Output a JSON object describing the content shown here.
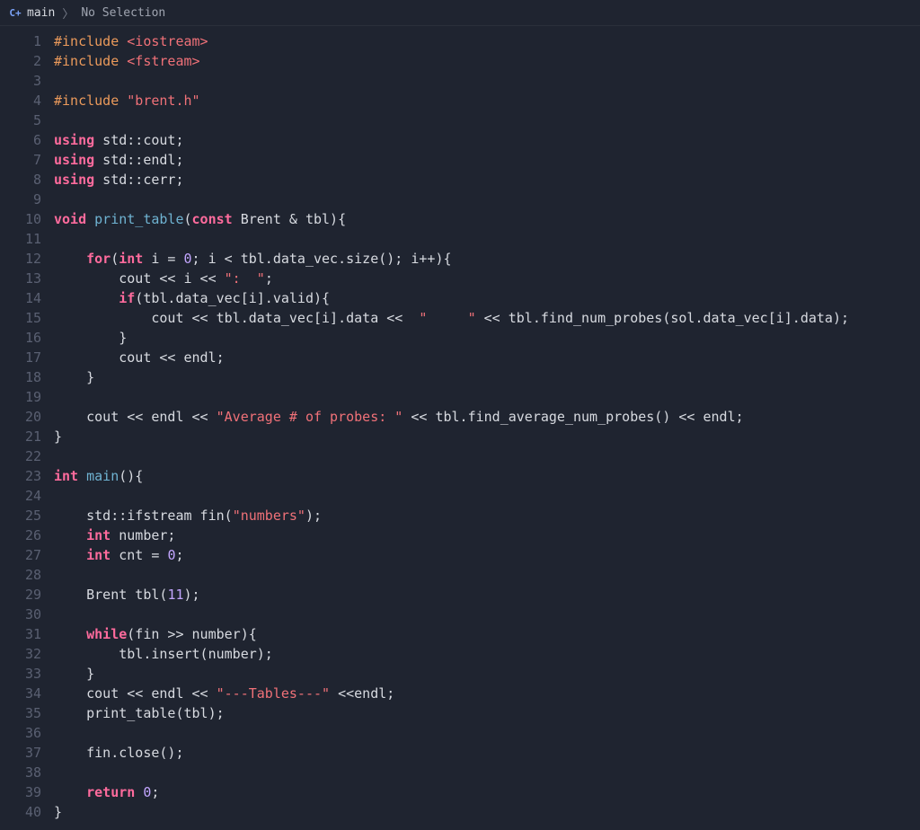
{
  "breadcrumb": {
    "icon_label": "C+",
    "file": "main",
    "selection": "No Selection"
  },
  "code_lines": [
    {
      "n": 1,
      "tokens": [
        [
          "preproc",
          "#include "
        ],
        [
          "string",
          "<iostream>"
        ]
      ]
    },
    {
      "n": 2,
      "tokens": [
        [
          "preproc",
          "#include "
        ],
        [
          "string",
          "<fstream>"
        ]
      ]
    },
    {
      "n": 3,
      "tokens": []
    },
    {
      "n": 4,
      "tokens": [
        [
          "preproc",
          "#include "
        ],
        [
          "string",
          "\"brent.h\""
        ]
      ]
    },
    {
      "n": 5,
      "tokens": []
    },
    {
      "n": 6,
      "tokens": [
        [
          "keyword",
          "using"
        ],
        [
          "plain",
          " std::cout;"
        ]
      ]
    },
    {
      "n": 7,
      "tokens": [
        [
          "keyword",
          "using"
        ],
        [
          "plain",
          " std::endl;"
        ]
      ]
    },
    {
      "n": 8,
      "tokens": [
        [
          "keyword",
          "using"
        ],
        [
          "plain",
          " std::cerr;"
        ]
      ]
    },
    {
      "n": 9,
      "tokens": []
    },
    {
      "n": 10,
      "tokens": [
        [
          "keyword",
          "void"
        ],
        [
          "plain",
          " "
        ],
        [
          "func",
          "print_table"
        ],
        [
          "plain",
          "("
        ],
        [
          "keyword",
          "const"
        ],
        [
          "plain",
          " Brent & tbl){"
        ]
      ]
    },
    {
      "n": 11,
      "tokens": []
    },
    {
      "n": 12,
      "tokens": [
        [
          "plain",
          "    "
        ],
        [
          "keyword",
          "for"
        ],
        [
          "plain",
          "("
        ],
        [
          "keyword",
          "int"
        ],
        [
          "plain",
          " i = "
        ],
        [
          "number",
          "0"
        ],
        [
          "plain",
          "; i < tbl.data_vec.size(); i++){"
        ]
      ]
    },
    {
      "n": 13,
      "tokens": [
        [
          "plain",
          "        cout << i << "
        ],
        [
          "string",
          "\":  \""
        ],
        [
          "plain",
          ";"
        ]
      ]
    },
    {
      "n": 14,
      "tokens": [
        [
          "plain",
          "        "
        ],
        [
          "keyword",
          "if"
        ],
        [
          "plain",
          "(tbl.data_vec[i].valid){"
        ]
      ]
    },
    {
      "n": 15,
      "tokens": [
        [
          "plain",
          "            cout << tbl.data_vec[i].data <<  "
        ],
        [
          "string",
          "\"     \""
        ],
        [
          "plain",
          " << tbl.find_num_probes(sol.data_vec[i].data);"
        ]
      ]
    },
    {
      "n": 16,
      "tokens": [
        [
          "plain",
          "        }"
        ]
      ]
    },
    {
      "n": 17,
      "tokens": [
        [
          "plain",
          "        cout << endl;"
        ]
      ]
    },
    {
      "n": 18,
      "tokens": [
        [
          "plain",
          "    }"
        ]
      ]
    },
    {
      "n": 19,
      "tokens": []
    },
    {
      "n": 20,
      "tokens": [
        [
          "plain",
          "    cout << endl << "
        ],
        [
          "string",
          "\"Average # of probes: \""
        ],
        [
          "plain",
          " << tbl.find_average_num_probes() << endl;"
        ]
      ]
    },
    {
      "n": 21,
      "tokens": [
        [
          "plain",
          "}"
        ]
      ]
    },
    {
      "n": 22,
      "tokens": []
    },
    {
      "n": 23,
      "tokens": [
        [
          "keyword",
          "int"
        ],
        [
          "plain",
          " "
        ],
        [
          "func",
          "main"
        ],
        [
          "plain",
          "(){"
        ]
      ]
    },
    {
      "n": 24,
      "tokens": []
    },
    {
      "n": 25,
      "tokens": [
        [
          "plain",
          "    std::ifstream fin("
        ],
        [
          "string",
          "\"numbers\""
        ],
        [
          "plain",
          ");"
        ]
      ]
    },
    {
      "n": 26,
      "tokens": [
        [
          "plain",
          "    "
        ],
        [
          "keyword",
          "int"
        ],
        [
          "plain",
          " number;"
        ]
      ]
    },
    {
      "n": 27,
      "tokens": [
        [
          "plain",
          "    "
        ],
        [
          "keyword",
          "int"
        ],
        [
          "plain",
          " cnt = "
        ],
        [
          "number",
          "0"
        ],
        [
          "plain",
          ";"
        ]
      ]
    },
    {
      "n": 28,
      "tokens": []
    },
    {
      "n": 29,
      "tokens": [
        [
          "plain",
          "    Brent tbl("
        ],
        [
          "number",
          "11"
        ],
        [
          "plain",
          ");"
        ]
      ]
    },
    {
      "n": 30,
      "tokens": []
    },
    {
      "n": 31,
      "tokens": [
        [
          "plain",
          "    "
        ],
        [
          "keyword",
          "while"
        ],
        [
          "plain",
          "(fin >> number){"
        ]
      ]
    },
    {
      "n": 32,
      "tokens": [
        [
          "plain",
          "        tbl.insert(number);"
        ]
      ]
    },
    {
      "n": 33,
      "tokens": [
        [
          "plain",
          "    }"
        ]
      ]
    },
    {
      "n": 34,
      "tokens": [
        [
          "plain",
          "    cout << endl << "
        ],
        [
          "string",
          "\"---Tables---\""
        ],
        [
          "plain",
          " <<endl;"
        ]
      ]
    },
    {
      "n": 35,
      "tokens": [
        [
          "plain",
          "    print_table(tbl);"
        ]
      ]
    },
    {
      "n": 36,
      "tokens": []
    },
    {
      "n": 37,
      "tokens": [
        [
          "plain",
          "    fin.close();"
        ]
      ]
    },
    {
      "n": 38,
      "tokens": []
    },
    {
      "n": 39,
      "tokens": [
        [
          "plain",
          "    "
        ],
        [
          "keyword",
          "return"
        ],
        [
          "plain",
          " "
        ],
        [
          "number",
          "0"
        ],
        [
          "plain",
          ";"
        ]
      ]
    },
    {
      "n": 40,
      "tokens": [
        [
          "plain",
          "}"
        ]
      ]
    }
  ]
}
